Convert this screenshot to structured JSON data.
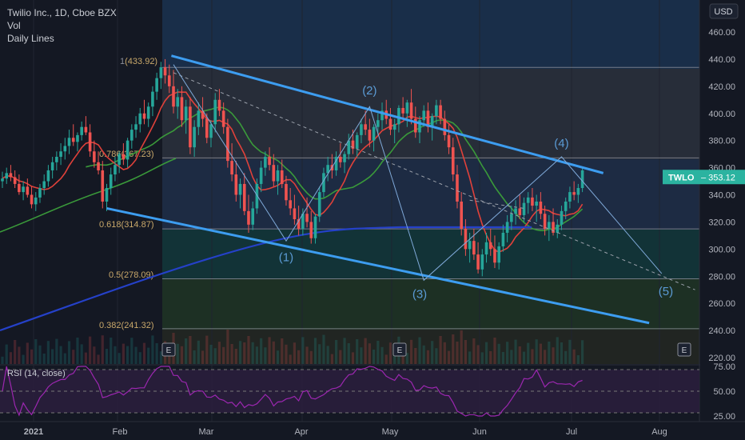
{
  "header": {
    "title": "Twilio Inc., 1D, Cboe BZX",
    "line2": "Vol",
    "line3": "Daily Lines",
    "currency": "USD"
  },
  "ticker_badge": {
    "symbol": "TWLO",
    "price": "353.12"
  },
  "rsi_label": "RSI (14, close)",
  "colors": {
    "up": "#26a69a",
    "down": "#ef5350",
    "channel": "#3d9df0",
    "wave": "#5b9bd5",
    "ma_red": "#e0413a",
    "ma_green": "#3a9a3a",
    "ma_blue": "#2541c9",
    "rsi": "#9c27b0"
  },
  "chart_data": {
    "type": "candlestick",
    "symbol": "TWLO",
    "timeframe": "1D",
    "x_axis_labels": [
      "2021",
      "Feb",
      "Mar",
      "Apr",
      "May",
      "Jun",
      "Jul",
      "Aug"
    ],
    "y_axis_ticks": [
      220,
      240,
      260,
      280,
      300,
      320,
      340,
      360,
      380,
      400,
      420,
      440,
      460
    ],
    "ylim": [
      213,
      470
    ],
    "rsi_ticks": [
      "25.00",
      "50.00",
      "75.00"
    ],
    "last_price": 353.12,
    "fib_levels": [
      {
        "label": "1(433.92)",
        "value": 433.92
      },
      {
        "label": "0.786(367.23)",
        "value": 367.23
      },
      {
        "label": "0.618(314.87)",
        "value": 314.87
      },
      {
        "label": "0.5(278.09)",
        "value": 278.09
      },
      {
        "label": "0.382(241.32)",
        "value": 241.32
      }
    ],
    "wave_labels": [
      "(1)",
      "(2)",
      "(3)",
      "(4)",
      "(5)"
    ],
    "earnings_markers": [
      "E",
      "E",
      "E"
    ],
    "ohlc": [
      [
        350,
        357,
        345,
        352
      ],
      [
        352,
        360,
        348,
        356
      ],
      [
        356,
        362,
        350,
        353
      ],
      [
        353,
        358,
        345,
        348
      ],
      [
        348,
        355,
        340,
        342
      ],
      [
        342,
        350,
        336,
        346
      ],
      [
        346,
        352,
        338,
        340
      ],
      [
        340,
        346,
        330,
        333
      ],
      [
        333,
        342,
        328,
        338
      ],
      [
        338,
        348,
        334,
        345
      ],
      [
        345,
        355,
        340,
        350
      ],
      [
        350,
        362,
        346,
        358
      ],
      [
        358,
        368,
        352,
        364
      ],
      [
        364,
        372,
        358,
        368
      ],
      [
        368,
        378,
        362,
        372
      ],
      [
        372,
        382,
        366,
        376
      ],
      [
        376,
        388,
        370,
        382
      ],
      [
        382,
        392,
        376,
        379
      ],
      [
        379,
        386,
        372,
        384
      ],
      [
        384,
        394,
        380,
        390
      ],
      [
        390,
        398,
        384,
        386
      ],
      [
        386,
        392,
        368,
        372
      ],
      [
        372,
        380,
        360,
        364
      ],
      [
        364,
        372,
        355,
        358
      ],
      [
        358,
        365,
        330,
        335
      ],
      [
        335,
        348,
        328,
        345
      ],
      [
        345,
        360,
        340,
        355
      ],
      [
        355,
        368,
        350,
        362
      ],
      [
        362,
        372,
        356,
        370
      ],
      [
        370,
        378,
        362,
        366
      ],
      [
        366,
        382,
        360,
        380
      ],
      [
        380,
        392,
        374,
        388
      ],
      [
        388,
        398,
        382,
        392
      ],
      [
        392,
        404,
        386,
        400
      ],
      [
        400,
        410,
        392,
        396
      ],
      [
        396,
        408,
        390,
        405
      ],
      [
        405,
        420,
        398,
        416
      ],
      [
        416,
        430,
        410,
        426
      ],
      [
        426,
        438,
        418,
        434
      ],
      [
        434,
        440,
        422,
        428
      ],
      [
        428,
        436,
        415,
        420
      ],
      [
        420,
        432,
        400,
        405
      ],
      [
        405,
        418,
        396,
        412
      ],
      [
        412,
        420,
        390,
        395
      ],
      [
        395,
        410,
        385,
        405
      ],
      [
        405,
        412,
        370,
        375
      ],
      [
        375,
        395,
        368,
        390
      ],
      [
        390,
        408,
        384,
        402
      ],
      [
        402,
        412,
        390,
        396
      ],
      [
        396,
        400,
        378,
        382
      ],
      [
        382,
        395,
        375,
        392
      ],
      [
        392,
        415,
        386,
        410
      ],
      [
        410,
        418,
        398,
        402
      ],
      [
        402,
        408,
        385,
        390
      ],
      [
        390,
        396,
        360,
        365
      ],
      [
        365,
        378,
        350,
        355
      ],
      [
        355,
        365,
        335,
        340
      ],
      [
        340,
        352,
        330,
        348
      ],
      [
        348,
        356,
        325,
        328
      ],
      [
        328,
        340,
        312,
        318
      ],
      [
        318,
        335,
        314,
        330
      ],
      [
        330,
        352,
        326,
        348
      ],
      [
        348,
        365,
        342,
        360
      ],
      [
        360,
        372,
        354,
        368
      ],
      [
        368,
        375,
        358,
        362
      ],
      [
        362,
        370,
        346,
        350
      ],
      [
        350,
        362,
        340,
        358
      ],
      [
        358,
        366,
        345,
        348
      ],
      [
        348,
        354,
        332,
        336
      ],
      [
        336,
        345,
        325,
        330
      ],
      [
        330,
        340,
        318,
        322
      ],
      [
        322,
        332,
        310,
        315
      ],
      [
        315,
        330,
        310,
        326
      ],
      [
        326,
        338,
        316,
        320
      ],
      [
        320,
        328,
        304,
        308
      ],
      [
        308,
        326,
        304,
        324
      ],
      [
        324,
        346,
        320,
        342
      ],
      [
        342,
        360,
        338,
        356
      ],
      [
        356,
        368,
        350,
        362
      ],
      [
        362,
        370,
        352,
        358
      ],
      [
        358,
        372,
        354,
        368
      ],
      [
        368,
        378,
        360,
        364
      ],
      [
        364,
        372,
        356,
        370
      ],
      [
        370,
        385,
        366,
        380
      ],
      [
        380,
        388,
        370,
        374
      ],
      [
        374,
        386,
        368,
        384
      ],
      [
        384,
        396,
        378,
        392
      ],
      [
        392,
        402,
        384,
        388
      ],
      [
        388,
        396,
        375,
        380
      ],
      [
        380,
        392,
        372,
        390
      ],
      [
        390,
        400,
        384,
        395
      ],
      [
        395,
        408,
        388,
        402
      ],
      [
        402,
        410,
        392,
        396
      ],
      [
        396,
        404,
        384,
        388
      ],
      [
        388,
        396,
        378,
        392
      ],
      [
        392,
        406,
        386,
        404
      ],
      [
        404,
        412,
        396,
        400
      ],
      [
        400,
        410,
        390,
        408
      ],
      [
        408,
        418,
        392,
        396
      ],
      [
        396,
        405,
        382,
        386
      ],
      [
        386,
        398,
        378,
        395
      ],
      [
        395,
        406,
        390,
        402
      ],
      [
        402,
        408,
        386,
        390
      ],
      [
        390,
        400,
        380,
        398
      ],
      [
        398,
        410,
        392,
        406
      ],
      [
        406,
        410,
        392,
        396
      ],
      [
        396,
        402,
        380,
        384
      ],
      [
        384,
        392,
        370,
        375
      ],
      [
        375,
        382,
        350,
        355
      ],
      [
        355,
        362,
        330,
        335
      ],
      [
        335,
        342,
        310,
        315
      ],
      [
        315,
        322,
        295,
        300
      ],
      [
        300,
        312,
        290,
        306
      ],
      [
        306,
        315,
        292,
        296
      ],
      [
        296,
        305,
        282,
        285
      ],
      [
        285,
        300,
        280,
        296
      ],
      [
        296,
        312,
        290,
        305
      ],
      [
        305,
        315,
        295,
        300
      ],
      [
        300,
        310,
        286,
        290
      ],
      [
        290,
        305,
        285,
        302
      ],
      [
        302,
        318,
        298,
        312
      ],
      [
        312,
        325,
        305,
        320
      ],
      [
        320,
        332,
        314,
        326
      ],
      [
        326,
        336,
        318,
        330
      ],
      [
        330,
        340,
        322,
        325
      ],
      [
        325,
        338,
        320,
        334
      ],
      [
        334,
        342,
        326,
        338
      ],
      [
        338,
        345,
        328,
        332
      ],
      [
        332,
        340,
        320,
        335
      ],
      [
        335,
        342,
        322,
        326
      ],
      [
        326,
        332,
        310,
        315
      ],
      [
        315,
        325,
        306,
        320
      ],
      [
        320,
        330,
        310,
        312
      ],
      [
        312,
        322,
        308,
        318
      ],
      [
        318,
        332,
        314,
        328
      ],
      [
        328,
        338,
        322,
        335
      ],
      [
        335,
        346,
        330,
        342
      ],
      [
        342,
        350,
        336,
        340
      ],
      [
        340,
        348,
        334,
        345
      ],
      [
        345,
        360,
        342,
        358
      ]
    ]
  }
}
